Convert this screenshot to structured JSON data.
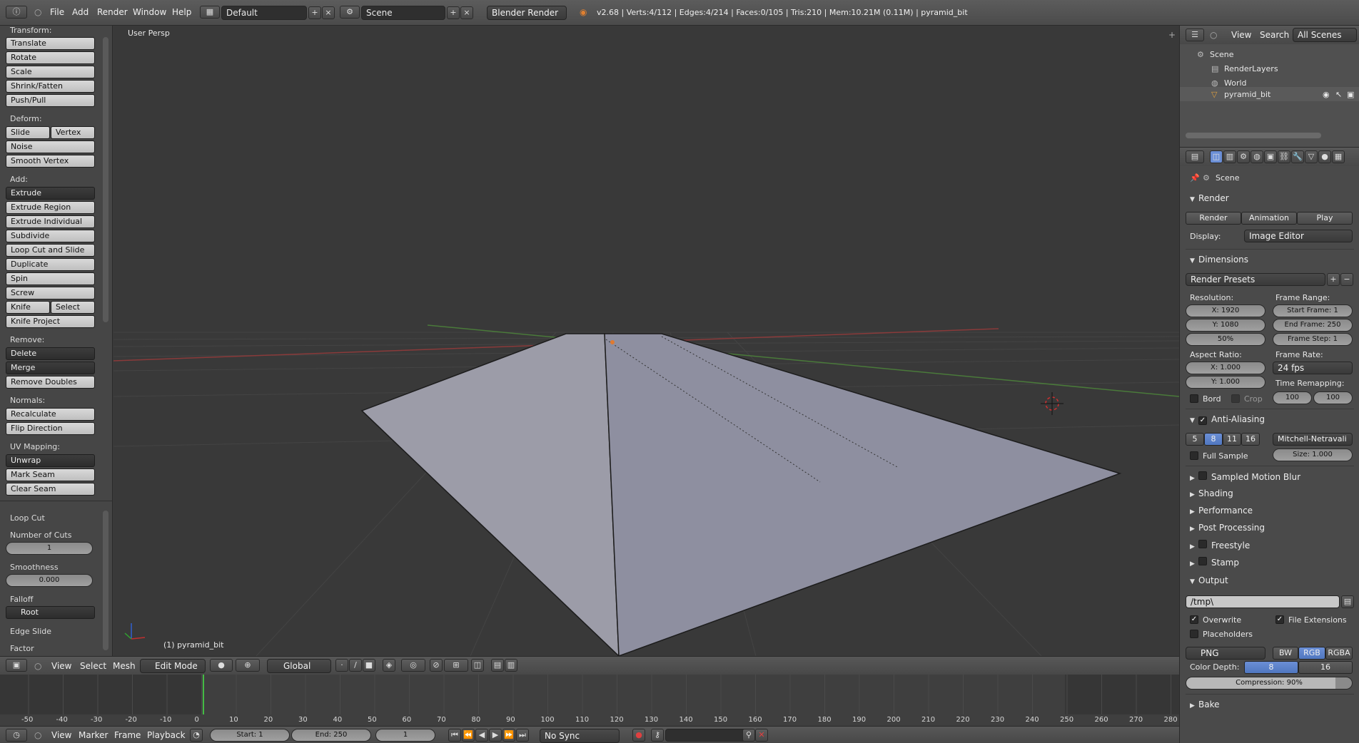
{
  "topbar": {
    "menus": [
      "File",
      "Add",
      "Render",
      "Window",
      "Help"
    ],
    "layout": "Default",
    "scene": "Scene",
    "engine": "Blender Render",
    "stats": "v2.68 | Verts:4/112 | Edges:4/214 | Faces:0/105 | Tris:210 | Mem:10.21M (0.11M) | pyramid_bit"
  },
  "toolshelf": {
    "transform_label": "Transform:",
    "transform": [
      "Translate",
      "Rotate",
      "Scale",
      "Shrink/Fatten",
      "Push/Pull"
    ],
    "deform_label": "Deform:",
    "slide_edge": "Slide Edge",
    "vertex": "Vertex",
    "noise": "Noise",
    "smooth_vertex": "Smooth Vertex",
    "add_label": "Add:",
    "extrude": "Extrude",
    "add": [
      "Extrude Region",
      "Extrude Individual",
      "Subdivide",
      "Loop Cut and Slide",
      "Duplicate",
      "Spin",
      "Screw"
    ],
    "knife": "Knife",
    "select": "Select",
    "knife_project": "Knife Project",
    "remove_label": "Remove:",
    "delete": "Delete",
    "merge": "Merge",
    "remove_doubles": "Remove Doubles",
    "normals_label": "Normals:",
    "recalculate": "Recalculate",
    "flip_direction": "Flip Direction",
    "uv_label": "UV Mapping:",
    "unwrap": "Unwrap",
    "mark_seam": "Mark Seam",
    "clear_seam": "Clear Seam",
    "op_title": "Loop Cut",
    "cuts_label": "Number of Cuts",
    "cuts_value": "1",
    "smooth_label": "Smoothness",
    "smooth_value": "0.000",
    "falloff_label": "Falloff",
    "falloff_value": "Root",
    "edge_slide": "Edge Slide",
    "factor": "Factor"
  },
  "viewport": {
    "view_name": "User Persp",
    "object_label": "(1) pyramid_bit"
  },
  "viewport_header": {
    "menus": [
      "View",
      "Select",
      "Mesh"
    ],
    "mode": "Edit Mode",
    "orientation": "Global"
  },
  "timeline": {
    "ticks": [
      "-50",
      "-40",
      "-30",
      "-20",
      "-10",
      "0",
      "10",
      "20",
      "30",
      "40",
      "50",
      "60",
      "70",
      "80",
      "90",
      "100",
      "110",
      "120",
      "130",
      "140",
      "150",
      "160",
      "170",
      "180",
      "190",
      "200",
      "210",
      "220",
      "230",
      "240",
      "250",
      "260",
      "270",
      "280"
    ],
    "menus": [
      "View",
      "Marker",
      "Frame",
      "Playback"
    ],
    "start": "Start: 1",
    "end": "End: 250",
    "current": "1",
    "sync": "No Sync"
  },
  "outliner": {
    "menus": [
      "View",
      "Search"
    ],
    "filter": "All Scenes",
    "items": [
      "Scene",
      "RenderLayers",
      "World",
      "pyramid_bit"
    ]
  },
  "properties": {
    "context": "Scene",
    "render_head": "Render",
    "render_btn": "Render",
    "animation_btn": "Animation",
    "play_btn": "Play",
    "display_label": "Display:",
    "display_value": "Image Editor",
    "dimensions_head": "Dimensions",
    "presets": "Render Presets",
    "resolution_label": "Resolution:",
    "res_x": "X: 1920",
    "res_y": "Y: 1080",
    "res_pct": "50%",
    "frame_range_label": "Frame Range:",
    "start_frame": "Start Frame: 1",
    "end_frame": "End Frame: 250",
    "frame_step": "Frame Step: 1",
    "aspect_label": "Aspect Ratio:",
    "aspect_x": "X: 1.000",
    "aspect_y": "Y: 1.000",
    "frame_rate_label": "Frame Rate:",
    "frame_rate": "24 fps",
    "time_remap_label": "Time Remapping:",
    "remap_old": "100",
    "remap_new": "100",
    "bord": "Bord",
    "crop": "Crop",
    "aa_head": "Anti-Aliasing",
    "aa_samples": [
      "5",
      "8",
      "11",
      "16"
    ],
    "aa_filter": "Mitchell-Netravali",
    "full_sample": "Full Sample",
    "aa_size": "Size: 1.000",
    "collapsed": [
      "Sampled Motion Blur",
      "Shading",
      "Performance",
      "Post Processing",
      "Freestyle",
      "Stamp"
    ],
    "output_head": "Output",
    "output_path": "/tmp\\",
    "overwrite": "Overwrite",
    "file_ext": "File Extensions",
    "placeholders": "Placeholders",
    "format": "PNG",
    "color_modes": [
      "BW",
      "RGB",
      "RGBA"
    ],
    "color_depth_label": "Color Depth:",
    "depth_8": "8",
    "depth_16": "16",
    "compression": "Compression: 90%",
    "bake_head": "Bake"
  },
  "colors": {
    "accent_blue": "#5077c0",
    "mesh_face": "#9a9aa6",
    "grid_red": "#8a3a3a",
    "grid_green": "#4a7a3a",
    "playhead": "#44aa44"
  }
}
